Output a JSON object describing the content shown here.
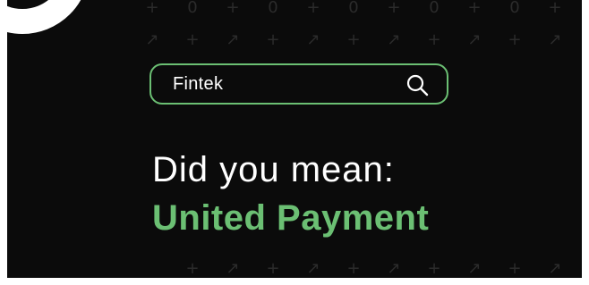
{
  "search": {
    "query": "Fintek"
  },
  "prompt": {
    "label": "Did you mean:"
  },
  "suggestion": {
    "text": "United Payment"
  },
  "colors": {
    "accent": "#6bbf73",
    "background": "#0b0b0b",
    "text": "#ffffff",
    "pattern": "#2b2b2b"
  },
  "icons": {
    "search": "search-icon",
    "background_pattern": [
      "plus-glyph",
      "zero-glyph",
      "link-glyph"
    ]
  }
}
